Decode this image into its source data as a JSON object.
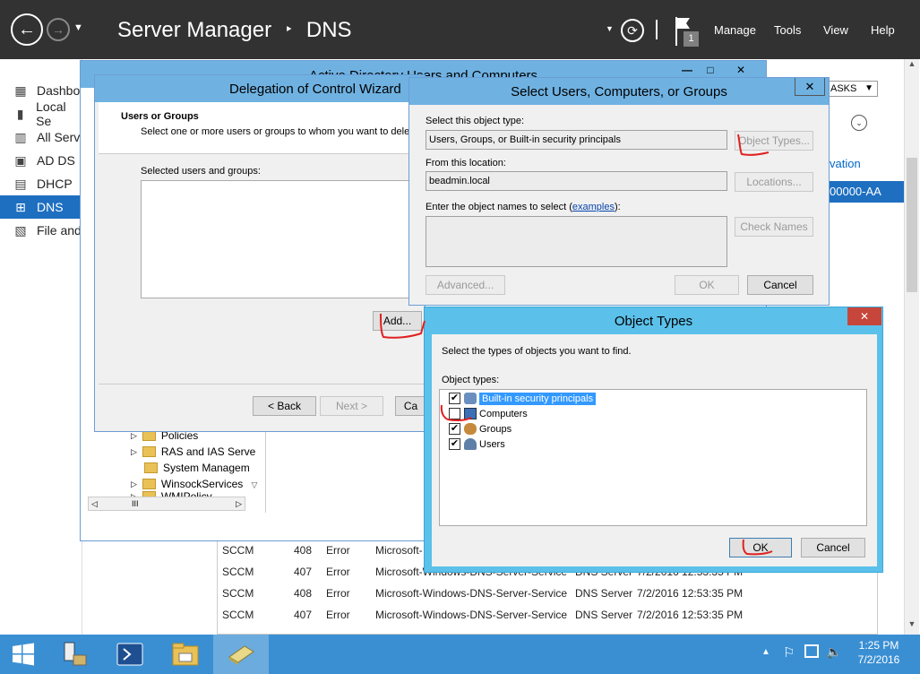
{
  "server_manager": {
    "title": "Server Manager",
    "separator": "‣",
    "section": "DNS",
    "notification_count": "1",
    "menu": {
      "manage": "Manage",
      "tools": "Tools",
      "view": "View",
      "help": "Help"
    },
    "nav": [
      {
        "label": "Dashbo",
        "icon": "dashboard-icon"
      },
      {
        "label": "Local Se",
        "icon": "local-server-icon"
      },
      {
        "label": "All Serv",
        "icon": "all-servers-icon"
      },
      {
        "label": "AD DS",
        "icon": "ad-ds-icon"
      },
      {
        "label": "DHCP",
        "icon": "dhcp-icon"
      },
      {
        "label": "DNS",
        "icon": "dns-icon",
        "active": true
      },
      {
        "label": "File and",
        "icon": "file-services-icon"
      }
    ],
    "tasks_label": "ASKS",
    "activation_text": "vation",
    "guid_text": "00000-AA",
    "events": [
      {
        "server": "SCCM",
        "id": "408",
        "severity": "Error",
        "source": "Microsoft-",
        "log": "",
        "datetime": ""
      },
      {
        "server": "SCCM",
        "id": "407",
        "severity": "Error",
        "source": "Microsoft-Windows-DNS-Server-Service",
        "log": "DNS Server",
        "datetime": "7/2/2016 12:53:35 PM"
      },
      {
        "server": "SCCM",
        "id": "408",
        "severity": "Error",
        "source": "Microsoft-Windows-DNS-Server-Service",
        "log": "DNS Server",
        "datetime": "7/2/2016 12:53:35 PM"
      },
      {
        "server": "SCCM",
        "id": "407",
        "severity": "Error",
        "source": "Microsoft-Windows-DNS-Server-Service",
        "log": "DNS Server",
        "datetime": "7/2/2016 12:53:35 PM"
      }
    ]
  },
  "aduc": {
    "title": "Active Directory Users and Computers",
    "tree": [
      "Policies",
      "RAS and IAS Serve",
      "System Managem",
      "WinsockServices",
      "WMIPolicy"
    ],
    "hscroll_label": "III"
  },
  "delegation_wizard": {
    "title": "Delegation of Control Wizard",
    "heading": "Users or Groups",
    "description": "Select one or more users or groups to whom you want to delega",
    "selected_label": "Selected users and groups:",
    "add_button": "Add...",
    "back_button": "< Back",
    "next_button": "Next >",
    "cancel_button": "Ca"
  },
  "select_users": {
    "title": "Select Users, Computers, or Groups",
    "object_type_label": "Select this object type:",
    "object_type_value": "Users, Groups, or Built-in security principals",
    "object_types_button": "Object Types...",
    "location_label": "From this location:",
    "location_value": "beadmin.local",
    "locations_button": "Locations...",
    "names_label_pre": "Enter the object names to select (",
    "names_label_link": "examples",
    "names_label_post": "):",
    "check_names_button": "Check Names",
    "advanced_button": "Advanced...",
    "ok_button": "OK",
    "cancel_button": "Cancel"
  },
  "object_types": {
    "title": "Object Types",
    "instruction": "Select the types of objects you want to find.",
    "list_label": "Object types:",
    "items": [
      {
        "label": "Built-in security principals",
        "checked": true,
        "selected": true
      },
      {
        "label": "Computers",
        "checked": false
      },
      {
        "label": "Groups",
        "checked": true
      },
      {
        "label": "Users",
        "checked": true
      }
    ],
    "ok_button": "OK",
    "cancel_button": "Cancel"
  },
  "taskbar": {
    "time": "1:25 PM",
    "date": "7/2/2016"
  },
  "colors": {
    "header": "#323232",
    "accent": "#1e6fc0",
    "taskbar": "#3a8fd3",
    "dialog_title_active": "#5bc1ea",
    "annotation_red": "#e02020"
  }
}
